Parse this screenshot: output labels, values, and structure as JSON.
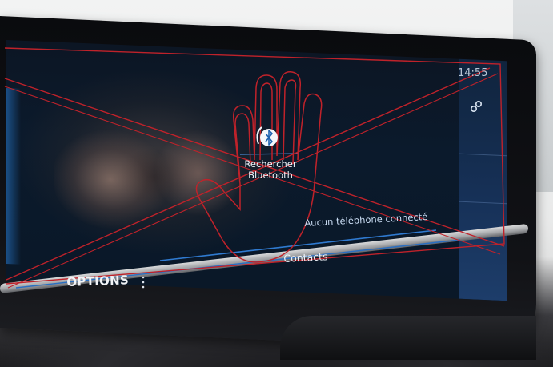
{
  "screen": {
    "clock": "14:55",
    "bluetooth_button_label_line1": "Rechercher",
    "bluetooth_button_label_line2": "Bluetooth",
    "status_text": "Aucun téléphone connecté",
    "tab_label": "Contacts",
    "options_label": "OPTIONS"
  },
  "colors": {
    "overlay_red": "#c0222a",
    "screen_blue": "#1e62b0",
    "text_light": "#eef2f8"
  },
  "icons": {
    "settings": "settings-icon",
    "bluetooth": "bluetooth-icon",
    "options_menu": "vertical-dots-icon",
    "overlay_hand": "stop-hand-icon"
  }
}
